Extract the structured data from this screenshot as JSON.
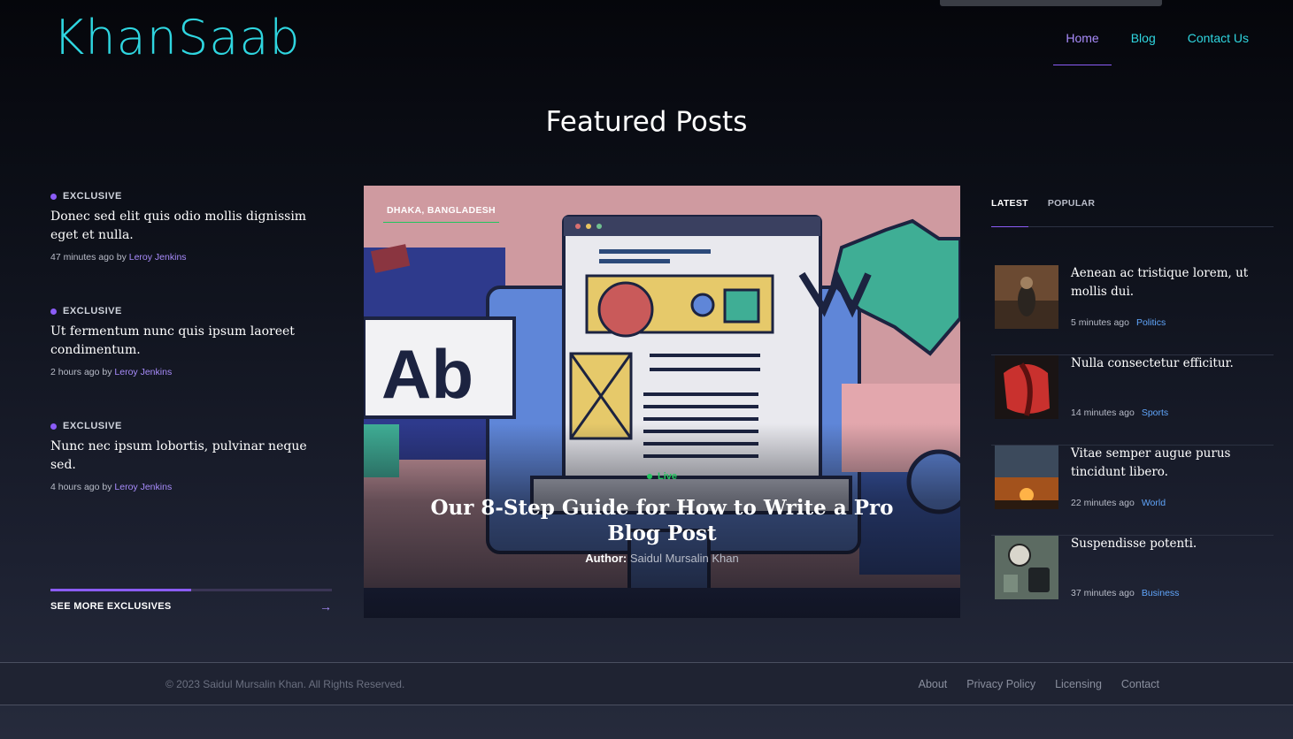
{
  "brand": {
    "name": "KhanSaab",
    "color": "#2fd6e0"
  },
  "nav": {
    "items": [
      {
        "label": "Home"
      },
      {
        "label": "Blog"
      },
      {
        "label": "Contact Us"
      }
    ]
  },
  "section_title": "Featured Posts",
  "exclusives": [
    {
      "tag": "EXCLUSIVE",
      "title": "Donec sed elit quis odio mollis dignissim eget et nulla.",
      "time": "47 minutes ago",
      "by": "by",
      "author": "Leroy Jenkins"
    },
    {
      "tag": "EXCLUSIVE",
      "title": "Ut fermentum nunc quis ipsum laoreet condimentum.",
      "time": "2 hours ago",
      "by": "by",
      "author": "Leroy Jenkins"
    },
    {
      "tag": "EXCLUSIVE",
      "title": "Nunc nec ipsum lobortis, pulvinar neque sed.",
      "time": "4 hours ago",
      "by": "by",
      "author": "Leroy Jenkins"
    }
  ],
  "see_more": {
    "label": "SEE MORE EXCLUSIVES",
    "arrow_icon": "arrow-right-icon",
    "progress": 0.5
  },
  "hero": {
    "location": "DHAKA, BANGLADESH",
    "live": "Live",
    "title": "Our 8-Step Guide for How to Write a Pro Blog Post",
    "author_label": "Author:",
    "author_name": "Saidul Mursalin Khan",
    "illustration_text": "Ab"
  },
  "sidebar": {
    "tabs": [
      {
        "label": "LATEST"
      },
      {
        "label": "POPULAR"
      }
    ],
    "items": [
      {
        "title": "Aenean ac tristique lorem, ut mollis dui.",
        "time": "5 minutes ago",
        "category": "Politics"
      },
      {
        "title": "Nulla consectetur efficitur.",
        "time": "14 minutes ago",
        "category": "Sports"
      },
      {
        "title": "Vitae semper augue purus tincidunt libero.",
        "time": "22 minutes ago",
        "category": "World"
      },
      {
        "title": "Suspendisse potenti.",
        "time": "37 minutes ago",
        "category": "Business"
      }
    ]
  },
  "footer": {
    "copyright": "© 2023 Saidul Mursalin Khan. All Rights Reserved.",
    "links": [
      {
        "label": "About"
      },
      {
        "label": "Privacy Policy"
      },
      {
        "label": "Licensing"
      },
      {
        "label": "Contact"
      }
    ]
  },
  "colors": {
    "accent": "#8b5cf6",
    "live": "#22c55e",
    "category": "#60a5fa"
  }
}
